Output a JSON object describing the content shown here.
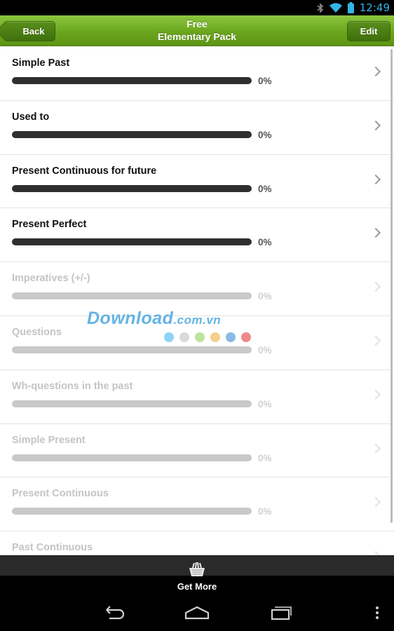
{
  "status_bar": {
    "time": "12:49",
    "icons": [
      "bluetooth-icon",
      "wifi-icon",
      "battery-icon"
    ],
    "accent": "#33b5e5"
  },
  "action_bar": {
    "back_label": "Back",
    "title_line1": "Free",
    "title_line2": "Elementary Pack",
    "edit_label": "Edit",
    "brand_color": "#6aa61d"
  },
  "lessons": [
    {
      "title": "Simple Past",
      "progress": "0%",
      "locked": false
    },
    {
      "title": "Used to",
      "progress": "0%",
      "locked": false
    },
    {
      "title": "Present Continuous for future",
      "progress": "0%",
      "locked": false
    },
    {
      "title": "Present Perfect",
      "progress": "0%",
      "locked": false
    },
    {
      "title": "Imperatives (+/-)",
      "progress": "0%",
      "locked": true
    },
    {
      "title": "Questions",
      "progress": "0%",
      "locked": true
    },
    {
      "title": "Wh-questions in the past",
      "progress": "0%",
      "locked": true
    },
    {
      "title": "Simple Present",
      "progress": "0%",
      "locked": true
    },
    {
      "title": "Present Continuous",
      "progress": "0%",
      "locked": true
    },
    {
      "title": "Past Continuous",
      "progress": "0%",
      "locked": true
    }
  ],
  "watermark": {
    "text": "Download",
    "suffix": ".com.vn",
    "dot_colors": [
      "#8fd3f5",
      "#d9d9d9",
      "#bfe3a0",
      "#f7cf8c",
      "#8ab9e6",
      "#f08a8a"
    ]
  },
  "bottom_bar": {
    "label": "Get More",
    "icon": "basket-icon"
  },
  "nav_bar": {
    "icons": [
      "back-nav-icon",
      "home-icon",
      "recents-icon",
      "overflow-menu-icon"
    ]
  }
}
